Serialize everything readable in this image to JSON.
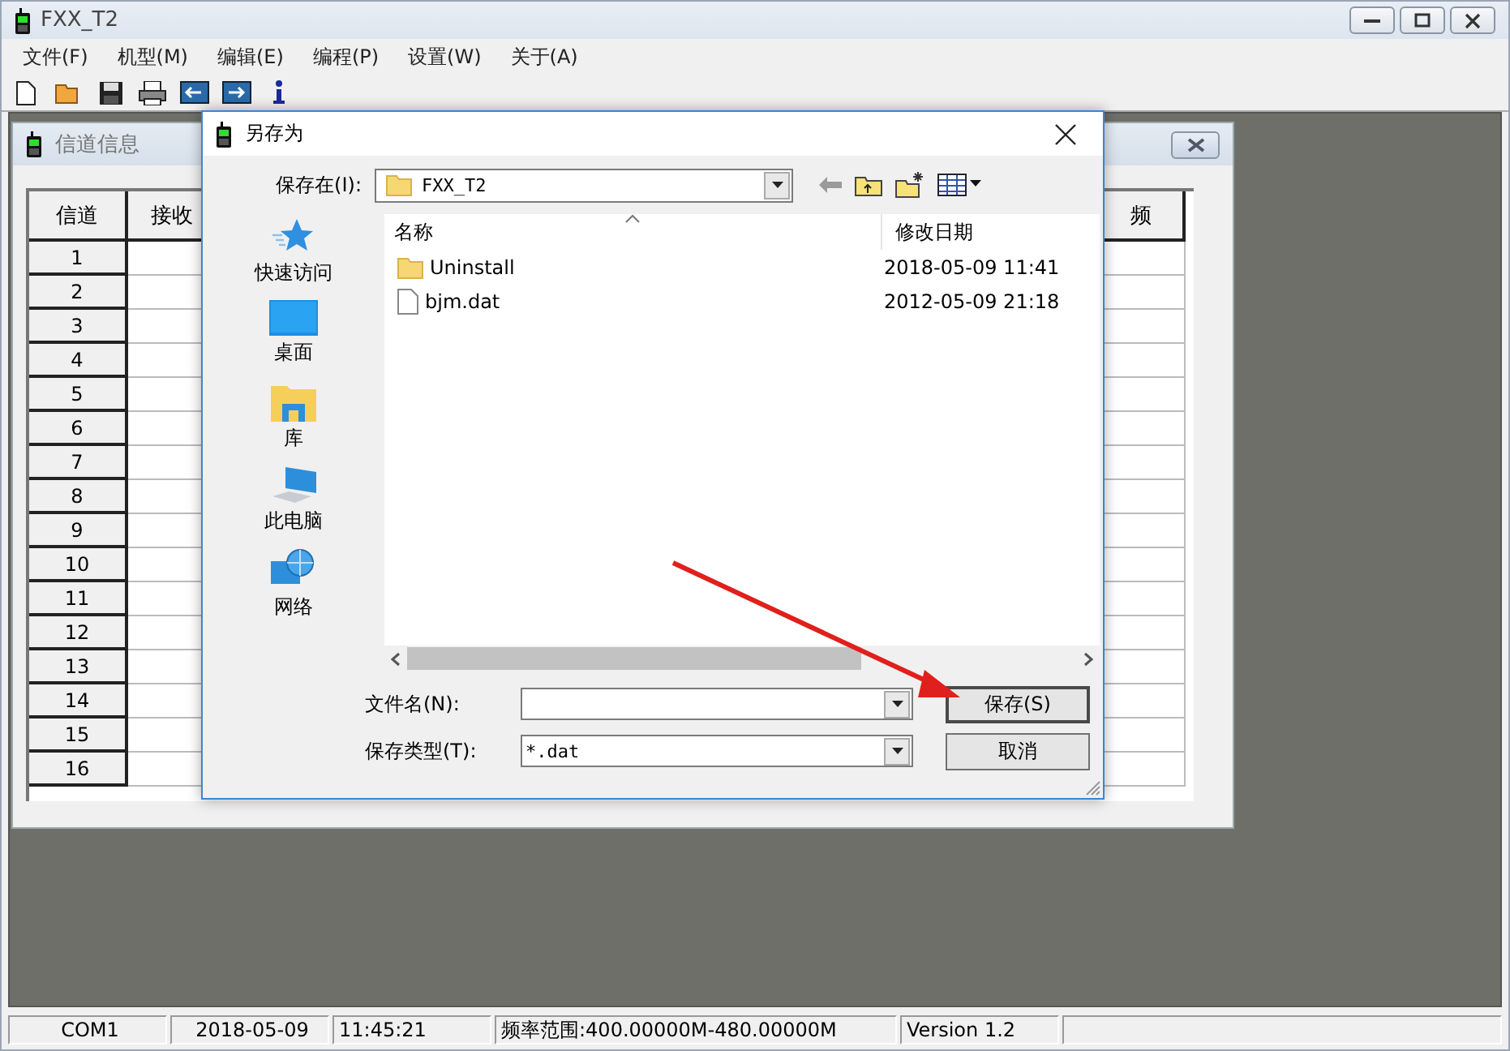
{
  "window": {
    "title": "FXX_T2"
  },
  "menu": [
    "文件(F)",
    "机型(M)",
    "编辑(E)",
    "编程(P)",
    "设置(W)",
    "关于(A)"
  ],
  "channel_window": {
    "title": "信道信息",
    "columns": [
      "信道",
      "接收",
      "频"
    ],
    "rows": [
      "1",
      "2",
      "3",
      "4",
      "5",
      "6",
      "7",
      "8",
      "9",
      "10",
      "11",
      "12",
      "13",
      "14",
      "15",
      "16"
    ]
  },
  "dialog": {
    "title": "另存为",
    "location_label": "保存在(I):",
    "location": "FXX_T2",
    "places": [
      {
        "kind": "quick",
        "label": "快速访问"
      },
      {
        "kind": "desktop",
        "label": "桌面"
      },
      {
        "kind": "library",
        "label": "库"
      },
      {
        "kind": "pc",
        "label": "此电脑"
      },
      {
        "kind": "network",
        "label": "网络"
      }
    ],
    "file_columns": [
      "名称",
      "修改日期"
    ],
    "files": [
      {
        "kind": "folder",
        "name": "Uninstall",
        "modified": "2018-05-09 11:41"
      },
      {
        "kind": "file",
        "name": "bjm.dat",
        "modified": "2012-05-09 21:18"
      }
    ],
    "filename_label": "文件名(N):",
    "filetype_label": "保存类型(T):",
    "filetype": "*.dat",
    "buttons": [
      "保存(S)",
      "取消"
    ]
  },
  "status_bar": [
    "COM1",
    "2018-05-09",
    "11:45:21",
    "频率范围:400.00000M-480.00000M",
    "Version 1.2"
  ]
}
